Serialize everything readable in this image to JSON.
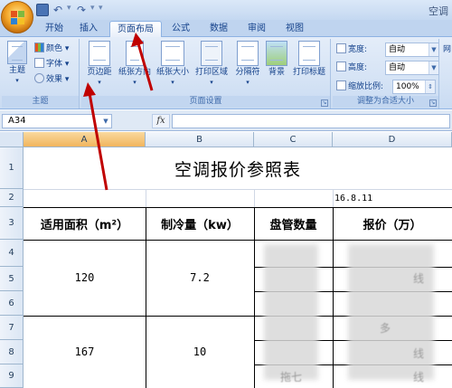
{
  "window": {
    "title": "空调"
  },
  "tabs": [
    "开始",
    "插入",
    "页面布局",
    "公式",
    "数据",
    "审阅",
    "视图"
  ],
  "active_tab": "页面布局",
  "ribbon": {
    "theme_group": {
      "label": "主题",
      "theme_btn": "主题",
      "colors": "颜色",
      "fonts": "字体",
      "effects": "效果"
    },
    "page_setup_group": {
      "label": "页面设置",
      "margins": "页边距",
      "orientation": "纸张方向",
      "size": "纸张大小",
      "print_area": "打印区域",
      "breaks": "分隔符",
      "background": "背景",
      "print_titles": "打印标题"
    },
    "scale_group": {
      "label": "调整为合适大小",
      "width_label": "宽度:",
      "width_value": "自动",
      "height_label": "高度:",
      "height_value": "自动",
      "scale_label": "缩放比例:",
      "scale_value": "100%"
    },
    "partial_group_label": "网"
  },
  "formula_bar": {
    "name_box": "A34",
    "fx": "fx",
    "content": ""
  },
  "grid": {
    "columns": [
      "A",
      "B",
      "C",
      "D"
    ],
    "rows": [
      "1",
      "2",
      "3",
      "4",
      "5",
      "6",
      "7",
      "8",
      "9"
    ],
    "title": "空调报价参照表",
    "date": "16.8.11",
    "headers": {
      "a": "适用面积（m²）",
      "b": "制冷量（kw）",
      "c": "盘管数量",
      "d": "报价（万）"
    },
    "rows_data": [
      {
        "area": "120",
        "cooling": "7.2"
      },
      {
        "area": "167",
        "cooling": "10"
      }
    ],
    "blurred_fragments": [
      "线",
      "线",
      "多",
      "线",
      "拖七"
    ]
  },
  "colors": {
    "accent_arrow": "#c00000",
    "ribbon_text": "#15428b"
  }
}
